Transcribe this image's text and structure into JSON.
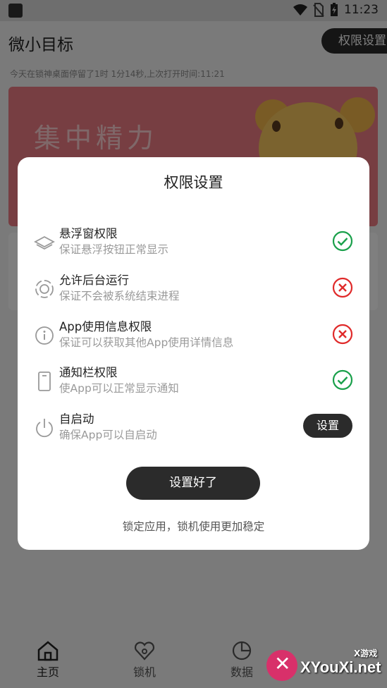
{
  "status_bar": {
    "time": "11:23"
  },
  "header": {
    "title": "微小目标",
    "permission_button": "权限设置"
  },
  "stay_info": "今天在锁神桌面停留了1时 1分14秒,上次打开时间:11:21",
  "banner": {
    "text": "集中精力"
  },
  "nav": {
    "items": [
      "主页",
      "锁机",
      "数据"
    ]
  },
  "dialog": {
    "title": "权限设置",
    "permissions": [
      {
        "name": "悬浮窗权限",
        "desc": "保证悬浮按钮正常显示",
        "status": "granted",
        "icon": "layers-icon"
      },
      {
        "name": "允许后台运行",
        "desc": "保证不会被系统结束进程",
        "status": "denied",
        "icon": "background-run-icon"
      },
      {
        "name": "App使用信息权限",
        "desc": "保证可以获取其他App使用详情信息",
        "status": "denied",
        "icon": "info-icon"
      },
      {
        "name": "通知栏权限",
        "desc": "使App可以正常显示通知",
        "status": "granted",
        "icon": "phone-icon"
      },
      {
        "name": "自启动",
        "desc": "确保App可以自启动",
        "status": "action",
        "icon": "power-icon",
        "action_label": "设置"
      }
    ],
    "done_button": "设置好了",
    "tip": "锁定应用，锁机使用更加稳定"
  },
  "watermark": {
    "text": "XYouXi.net",
    "small": "X游戏"
  },
  "colors": {
    "granted": "#1aa04b",
    "denied": "#e02a2a",
    "dark_button": "#2b2b2b",
    "banner": "#ee7c84"
  }
}
